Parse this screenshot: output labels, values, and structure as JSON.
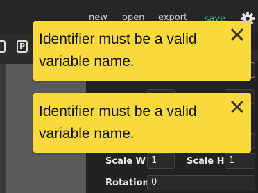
{
  "menu": {
    "new_label": "new",
    "open_label": "open",
    "export_label": "export",
    "save_label": "save"
  },
  "toolbar": {
    "icon2_glyph": "P"
  },
  "toasts": [
    {
      "message": "Identifier must be a valid variable name.",
      "close_glyph": "✕"
    },
    {
      "message": "Identifier must be a valid variable name.",
      "close_glyph": "✕"
    }
  ],
  "properties": {
    "scale_w_label": "Scale W",
    "scale_w_value": "1",
    "scale_h_label": "Scale H",
    "scale_h_value": "1",
    "rotation_label": "Rotation",
    "rotation_value": "0"
  },
  "colors": {
    "toast_bg": "#f9d93c",
    "save_accent": "#3fbf7f",
    "error_border": "#e06060"
  }
}
